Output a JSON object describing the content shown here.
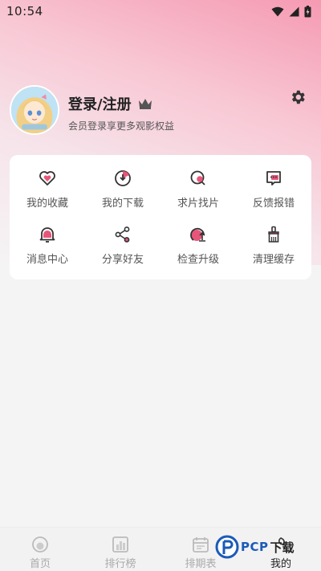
{
  "status_bar": {
    "time": "10:54"
  },
  "profile": {
    "title": "登录/注册",
    "subtitle": "会员登录享更多观影权益"
  },
  "menu": [
    {
      "label": "我的收藏",
      "icon": "heart-icon"
    },
    {
      "label": "我的下载",
      "icon": "download-icon"
    },
    {
      "label": "求片找片",
      "icon": "search-film-icon"
    },
    {
      "label": "反馈报错",
      "icon": "feedback-icon"
    },
    {
      "label": "消息中心",
      "icon": "bell-icon"
    },
    {
      "label": "分享好友",
      "icon": "share-icon"
    },
    {
      "label": "检查升级",
      "icon": "upgrade-icon"
    },
    {
      "label": "清理缓存",
      "icon": "clean-icon"
    }
  ],
  "tabs": [
    {
      "label": "首页",
      "icon": "home-icon",
      "active": false
    },
    {
      "label": "排行榜",
      "icon": "ranking-icon",
      "active": false
    },
    {
      "label": "排期表",
      "icon": "schedule-icon",
      "active": false
    },
    {
      "label": "我的",
      "icon": "mine-icon",
      "active": true
    }
  ],
  "watermark": {
    "brand": "PCP",
    "text": "下载"
  },
  "colors": {
    "accent": "#e8557a",
    "header_pink": "#f59ab2"
  }
}
